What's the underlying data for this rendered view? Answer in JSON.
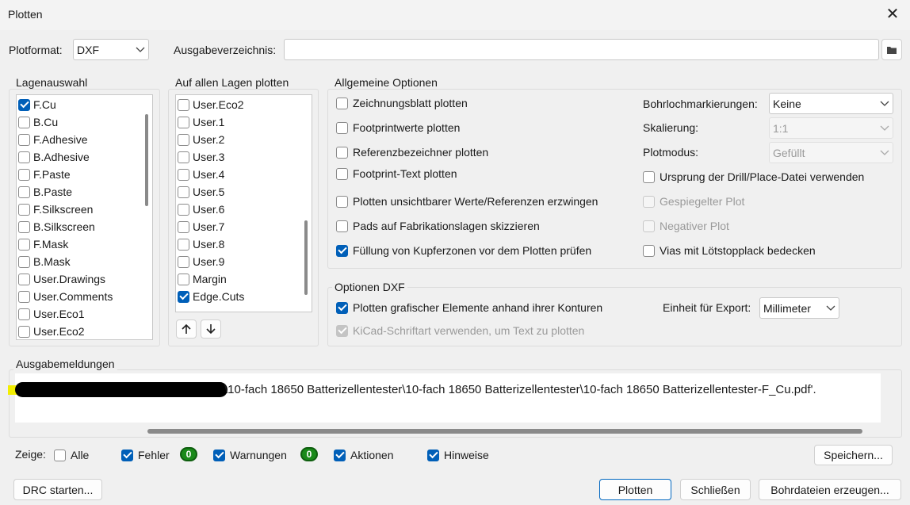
{
  "window": {
    "title": "Plotten"
  },
  "top": {
    "plotformat_label": "Plotformat:",
    "plotformat_value": "DXF",
    "outdir_label": "Ausgabeverzeichnis:",
    "outdir_value": ""
  },
  "layers": {
    "title": "Lagenauswahl",
    "items": [
      {
        "label": "F.Cu",
        "checked": true
      },
      {
        "label": "B.Cu",
        "checked": false
      },
      {
        "label": "F.Adhesive",
        "checked": false
      },
      {
        "label": "B.Adhesive",
        "checked": false
      },
      {
        "label": "F.Paste",
        "checked": false
      },
      {
        "label": "B.Paste",
        "checked": false
      },
      {
        "label": "F.Silkscreen",
        "checked": false
      },
      {
        "label": "B.Silkscreen",
        "checked": false
      },
      {
        "label": "F.Mask",
        "checked": false
      },
      {
        "label": "B.Mask",
        "checked": false
      },
      {
        "label": "User.Drawings",
        "checked": false
      },
      {
        "label": "User.Comments",
        "checked": false
      },
      {
        "label": "User.Eco1",
        "checked": false
      },
      {
        "label": "User.Eco2",
        "checked": false
      }
    ]
  },
  "all_layers": {
    "title": "Auf allen Lagen plotten",
    "items": [
      {
        "label": "User.Eco2",
        "checked": false
      },
      {
        "label": "User.1",
        "checked": false
      },
      {
        "label": "User.2",
        "checked": false
      },
      {
        "label": "User.3",
        "checked": false
      },
      {
        "label": "User.4",
        "checked": false
      },
      {
        "label": "User.5",
        "checked": false
      },
      {
        "label": "User.6",
        "checked": false
      },
      {
        "label": "User.7",
        "checked": false
      },
      {
        "label": "User.8",
        "checked": false
      },
      {
        "label": "User.9",
        "checked": false
      },
      {
        "label": "Margin",
        "checked": false
      },
      {
        "label": "Edge.Cuts",
        "checked": true
      }
    ]
  },
  "general": {
    "title": "Allgemeine Optionen",
    "left": [
      {
        "label": "Zeichnungsblatt plotten",
        "checked": false
      },
      {
        "label": "Footprintwerte plotten",
        "checked": false
      },
      {
        "label": "Referenzbezeichner plotten",
        "checked": false
      },
      {
        "label": "Footprint-Text plotten",
        "checked": false
      },
      {
        "label": "Plotten unsichtbarer Werte/Referenzen erzwingen",
        "checked": false
      },
      {
        "label": "Pads auf Fabrikationslagen skizzieren",
        "checked": false
      },
      {
        "label": "Füllung von Kupferzonen vor dem Plotten prüfen",
        "checked": true
      }
    ],
    "drill_label": "Bohrlochmarkierungen:",
    "drill_value": "Keine",
    "scale_label": "Skalierung:",
    "scale_value": "1:1",
    "mode_label": "Plotmodus:",
    "mode_value": "Gefüllt",
    "right": [
      {
        "label": "Ursprung der Drill/Place-Datei verwenden",
        "checked": false,
        "disabled": false
      },
      {
        "label": "Gespiegelter Plot",
        "checked": false,
        "disabled": true
      },
      {
        "label": "Negativer Plot",
        "checked": false,
        "disabled": true
      },
      {
        "label": "Vias mit Lötstopplack bedecken",
        "checked": false,
        "disabled": false
      }
    ]
  },
  "dxf": {
    "title": "Optionen DXF",
    "contours_label": "Plotten grafischer Elemente anhand ihrer Konturen",
    "contours_checked": true,
    "font_label": "KiCad-Schriftart verwenden, um Text zu plotten",
    "font_checked": true,
    "unit_label": "Einheit für Export:",
    "unit_value": "Millimeter"
  },
  "messages": {
    "title": "Ausgabemeldungen",
    "text": "\\10-fach 18650 Batterizellentester\\10-fach 18650 Batterizellentester\\10-fach 18650 Batterizellentester-F_Cu.pdf'."
  },
  "filters": {
    "show_label": "Zeige:",
    "all_label": "Alle",
    "errors_label": "Fehler",
    "errors_count": "0",
    "warnings_label": "Warnungen",
    "warnings_count": "0",
    "actions_label": "Aktionen",
    "infos_label": "Hinweise",
    "save_label": "Speichern..."
  },
  "buttons": {
    "drc": "DRC starten...",
    "plot": "Plotten",
    "close": "Schließen",
    "drill": "Bohrdateien erzeugen..."
  },
  "colors": {
    "accent": "#005fb8",
    "badge": "#1a8a1a"
  }
}
